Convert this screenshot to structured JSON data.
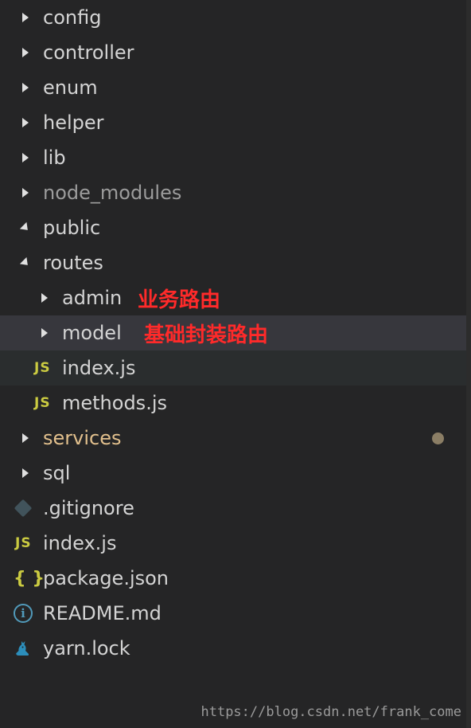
{
  "tree": {
    "items": [
      {
        "label": "config",
        "kind": "folder",
        "state": "collapsed"
      },
      {
        "label": "controller",
        "kind": "folder",
        "state": "collapsed"
      },
      {
        "label": "enum",
        "kind": "folder",
        "state": "collapsed"
      },
      {
        "label": "helper",
        "kind": "folder",
        "state": "collapsed"
      },
      {
        "label": "lib",
        "kind": "folder",
        "state": "collapsed"
      },
      {
        "label": "node_modules",
        "kind": "folder",
        "state": "collapsed",
        "style": "ignored"
      },
      {
        "label": "public",
        "kind": "folder",
        "state": "expanded"
      },
      {
        "label": "routes",
        "kind": "folder",
        "state": "expanded"
      },
      {
        "label": "admin",
        "kind": "folder",
        "state": "collapsed",
        "annotation": "业务路由"
      },
      {
        "label": "model",
        "kind": "folder",
        "state": "collapsed",
        "annotation": "基础封装路由"
      },
      {
        "label": "index.js",
        "kind": "file",
        "icon": "js-icon",
        "icon_text": "JS"
      },
      {
        "label": "methods.js",
        "kind": "file",
        "icon": "js-icon",
        "icon_text": "JS"
      },
      {
        "label": "services",
        "kind": "folder",
        "state": "collapsed",
        "style": "modified"
      },
      {
        "label": "sql",
        "kind": "folder",
        "state": "collapsed"
      },
      {
        "label": ".gitignore",
        "kind": "file",
        "icon": "git-icon"
      },
      {
        "label": "index.js",
        "kind": "file",
        "icon": "js-icon",
        "icon_text": "JS"
      },
      {
        "label": "package.json",
        "kind": "file",
        "icon": "json-icon",
        "icon_text": "{ }"
      },
      {
        "label": "README.md",
        "kind": "file",
        "icon": "info-icon",
        "icon_text": "i"
      },
      {
        "label": "yarn.lock",
        "kind": "file",
        "icon": "yarn-icon"
      }
    ]
  },
  "watermark": "https://blog.csdn.net/frank_come",
  "colors": {
    "background": "#252526",
    "text": "#d4d4d4",
    "annotation": "#ff2a2a",
    "modified": "#e2c08d",
    "js_icon": "#cbcb41",
    "info_icon": "#519aba",
    "modified_dot": "#8b7e65"
  }
}
